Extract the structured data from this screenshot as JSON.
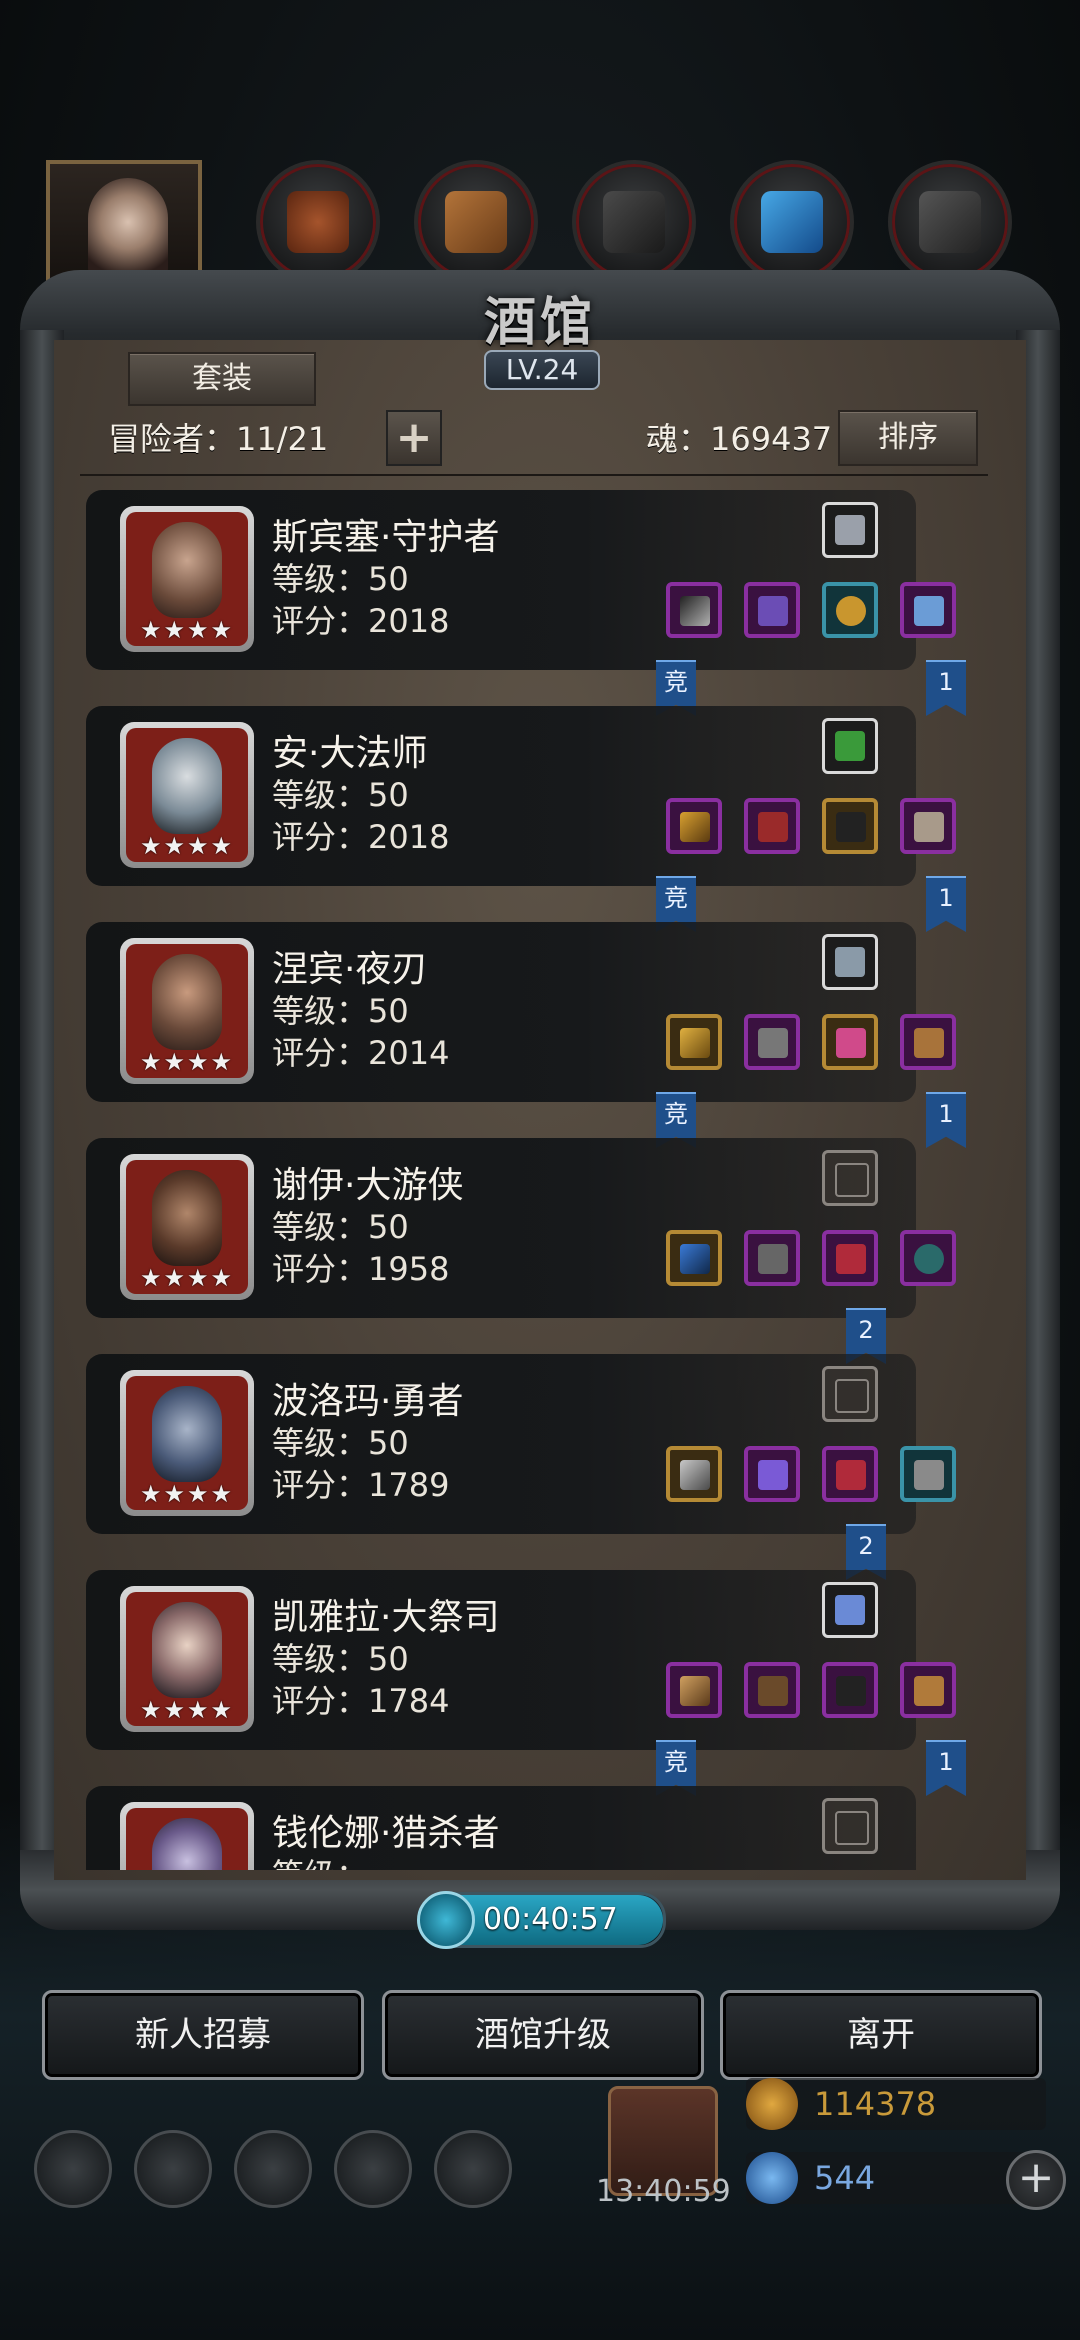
{
  "screen": {
    "title": "酒馆",
    "level": "LV.24"
  },
  "header": {
    "outfit_button": "套装",
    "adventurers_label": "冒险者：11/21",
    "soul_label": "魂：169437",
    "sort_button": "排序"
  },
  "tabs": [
    {
      "name": "hero-portrait"
    },
    {
      "name": "hair-tab"
    },
    {
      "name": "wood-tab"
    },
    {
      "name": "iron-tab"
    },
    {
      "name": "crystal-tab"
    },
    {
      "name": "stone-tab"
    }
  ],
  "heroes": [
    {
      "name": "斯宾塞·守护者",
      "level": "等级：50",
      "score": "评分：2018",
      "stars": "★★★★",
      "left_banner": "竞",
      "right_banner": "1"
    },
    {
      "name": "安·大法师",
      "level": "等级：50",
      "score": "评分：2018",
      "stars": "★★★★",
      "left_banner": "竞",
      "right_banner": "1"
    },
    {
      "name": "涅宾·夜刃",
      "level": "等级：50",
      "score": "评分：2014",
      "stars": "★★★★",
      "left_banner": "竞",
      "right_banner": "1"
    },
    {
      "name": "谢伊·大游侠",
      "level": "等级：50",
      "score": "评分：1958",
      "stars": "★★★★",
      "left_banner": "",
      "right_banner": "2"
    },
    {
      "name": "波洛玛·勇者",
      "level": "等级：50",
      "score": "评分：1789",
      "stars": "★★★★",
      "left_banner": "",
      "right_banner": "2"
    },
    {
      "name": "凯雅拉·大祭司",
      "level": "等级：50",
      "score": "评分：1784",
      "stars": "★★★★",
      "left_banner": "竞",
      "right_banner": "1"
    },
    {
      "name": "钱伦娜·猎杀者",
      "level": "等级：",
      "score": "",
      "stars": "",
      "left_banner": "",
      "right_banner": ""
    }
  ],
  "timer": {
    "value": "00:40:57"
  },
  "buttons": {
    "recruit": "新人招募",
    "upgrade": "酒馆升级",
    "leave": "离开"
  },
  "dock": {
    "clock": "13:40:59",
    "gold": "114378",
    "gems": "544",
    "add": "+"
  },
  "colors": {
    "gold_text": "#c99a3a",
    "gem_text": "#7aa8e0",
    "accent_red": "#7d1f18"
  }
}
